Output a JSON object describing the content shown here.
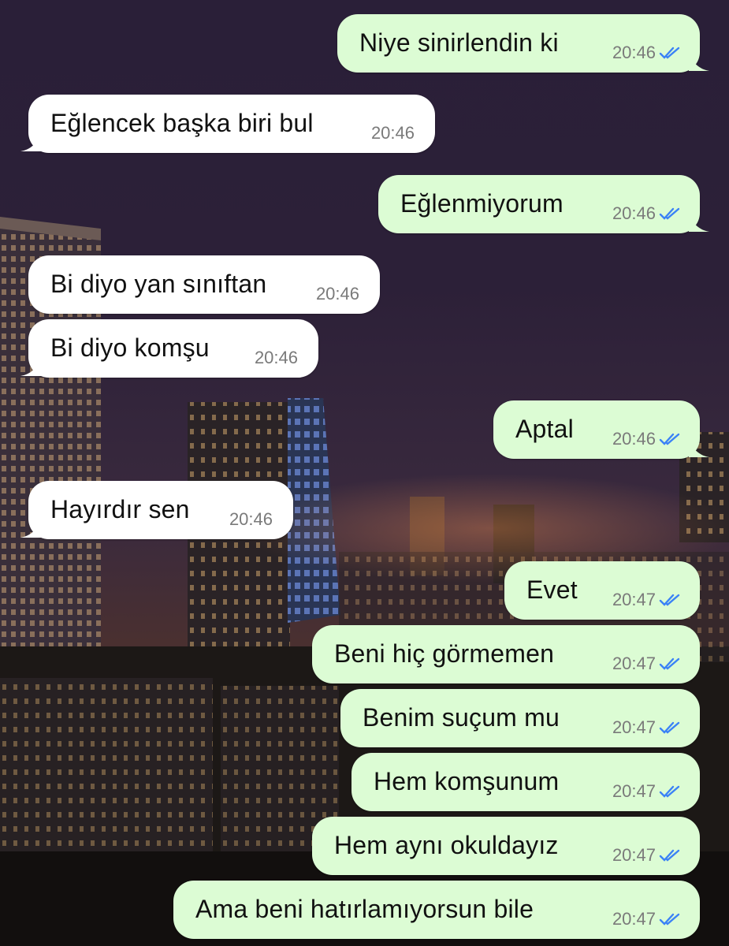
{
  "theme": {
    "incoming_bg": "#ffffff",
    "outgoing_bg": "#dcfcd4",
    "tick_color": "#3b82f6",
    "time_color": "#7a7a7a"
  },
  "messages": [
    {
      "dir": "out",
      "text": "Niye sinirlendin ki",
      "time": "20:46",
      "status": "read"
    },
    {
      "dir": "in",
      "text": "Eğlencek başka biri bul",
      "time": "20:46"
    },
    {
      "dir": "out",
      "text": "Eğlenmiyorum",
      "time": "20:46",
      "status": "read"
    },
    {
      "dir": "in",
      "text": "Bi diyo yan sınıftan",
      "time": "20:46"
    },
    {
      "dir": "in",
      "text": "Bi diyo komşu",
      "time": "20:46"
    },
    {
      "dir": "out",
      "text": "Aptal",
      "time": "20:46",
      "status": "read"
    },
    {
      "dir": "in",
      "text": "Hayırdır sen",
      "time": "20:46"
    },
    {
      "dir": "out",
      "text": "Evet",
      "time": "20:47",
      "status": "read"
    },
    {
      "dir": "out",
      "text": "Beni hiç görmemen",
      "time": "20:47",
      "status": "read"
    },
    {
      "dir": "out",
      "text": "Benim suçum mu",
      "time": "20:47",
      "status": "read"
    },
    {
      "dir": "out",
      "text": "Hem komşunum",
      "time": "20:47",
      "status": "read"
    },
    {
      "dir": "out",
      "text": "Hem aynı okuldayız",
      "time": "20:47",
      "status": "read"
    },
    {
      "dir": "out",
      "text": "Ama beni hatırlamıyorsun bile",
      "time": "20:47",
      "status": "read"
    }
  ]
}
